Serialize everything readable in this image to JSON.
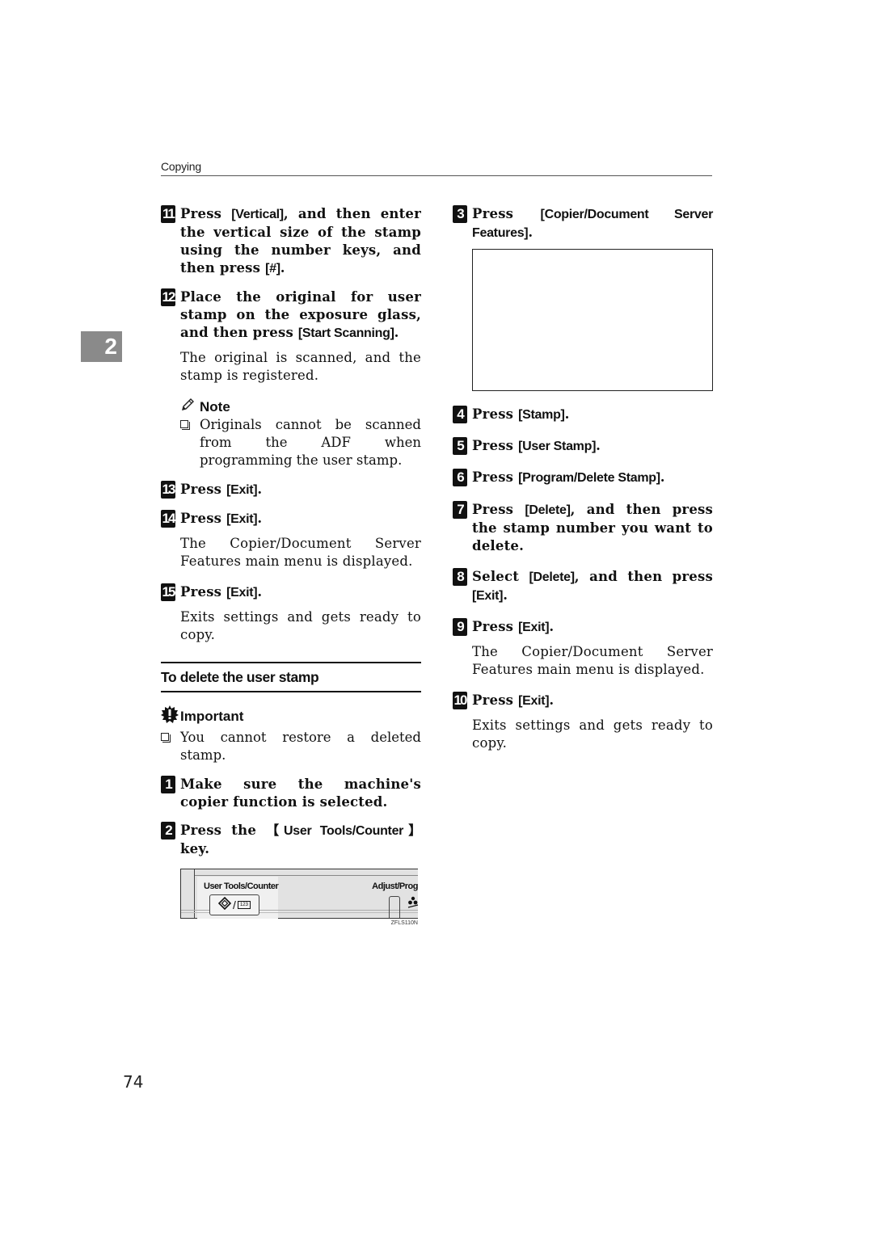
{
  "header": {
    "running_head": "Copying"
  },
  "chapter_tab": "2",
  "page_number": "74",
  "left_column": {
    "steps_a": [
      {
        "num": "11",
        "pre": "Press ",
        "key": "[Vertical]",
        "post": ", and then enter the vertical size of the stamp using the number keys, and then press ",
        "key2": "[#]",
        "post2": "."
      },
      {
        "num": "12",
        "pre": "Place the original for user stamp on the exposure glass, and then press ",
        "key": "[Start Scanning]",
        "post": ".",
        "desc": "The original is scanned, and the stamp is registered."
      }
    ],
    "note": {
      "title": "Note",
      "items": [
        "Originals cannot be scanned from the ADF when programming the user stamp."
      ]
    },
    "steps_b": [
      {
        "num": "13",
        "pre": "Press ",
        "key": "[Exit]",
        "post": "."
      },
      {
        "num": "14",
        "pre": "Press ",
        "key": "[Exit]",
        "post": ".",
        "desc": "The Copier/Document Server Features main menu is displayed."
      },
      {
        "num": "15",
        "pre": "Press ",
        "key": "[Exit]",
        "post": ".",
        "desc": "Exits settings and gets ready to copy."
      }
    ],
    "section_title": "To delete the user stamp",
    "important": {
      "title": "Important",
      "items": [
        "You cannot restore a deleted stamp."
      ]
    },
    "steps_c": [
      {
        "num": "1",
        "pre": "Make sure the machine's copier function is selected.",
        "key": "",
        "post": ""
      },
      {
        "num": "2",
        "pre": "Press the ",
        "key": "【User Tools/Counter】",
        "post": " key."
      }
    ],
    "panel_figure": {
      "label_left": "User Tools/Counter",
      "label_right": "Adjust/Prog",
      "key_badge": "123",
      "figure_code": "ZFLS110N"
    }
  },
  "right_column": {
    "step3": {
      "num": "3",
      "pre": "Press ",
      "key": "[Copier/Document Server Features]",
      "post": "."
    },
    "steps": [
      {
        "num": "4",
        "pre": "Press ",
        "key": "[Stamp]",
        "post": "."
      },
      {
        "num": "5",
        "pre": "Press ",
        "key": "[User Stamp]",
        "post": "."
      },
      {
        "num": "6",
        "pre": "Press ",
        "key": "[Program/Delete Stamp]",
        "post": "."
      },
      {
        "num": "7",
        "pre": "Press ",
        "key": "[Delete]",
        "post": ", and then press the stamp number you want to delete."
      },
      {
        "num": "8",
        "pre": "Select ",
        "key": "[Delete]",
        "post": ", and then press ",
        "key2": "[Exit]",
        "post2": "."
      },
      {
        "num": "9",
        "pre": "Press ",
        "key": "[Exit]",
        "post": ".",
        "desc": "The Copier/Document Server Features main menu is displayed."
      },
      {
        "num": "10",
        "pre": "Press ",
        "key": "[Exit]",
        "post": ".",
        "desc": "Exits settings and gets ready to copy."
      }
    ]
  }
}
